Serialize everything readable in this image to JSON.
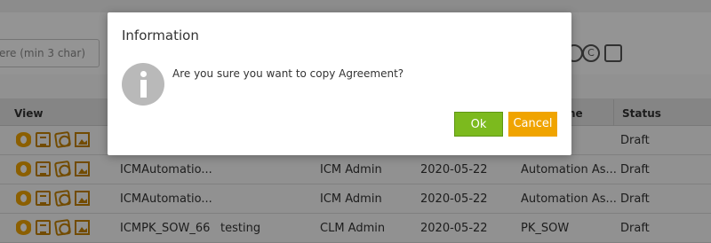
{
  "background": {
    "search": {
      "placeholder": "ere (min 3 char)"
    },
    "grid": {
      "columns": {
        "view": "View",
        "name": "me",
        "status": "Status"
      },
      "rows": [
        {
          "name": "",
          "col3": "",
          "owner": "",
          "date": "",
          "type": "",
          "status": "Draft"
        },
        {
          "name": "ICMAutomatio...",
          "col3": "",
          "owner": "ICM Admin",
          "date": "2020-05-22",
          "type": "Automation As...",
          "status": "Draft"
        },
        {
          "name": "ICMAutomatio...",
          "col3": "",
          "owner": "ICM Admin",
          "date": "2020-05-22",
          "type": "Automation As...",
          "status": "Draft"
        },
        {
          "name": "ICMPK_SOW_66",
          "col3": "testing",
          "owner": "CLM Admin",
          "date": "2020-05-22",
          "type": "PK_SOW",
          "status": "Draft"
        }
      ]
    }
  },
  "dialog": {
    "title": "Information",
    "message": "Are you sure you want to copy Agreement?",
    "ok_label": "Ok",
    "cancel_label": "Cancel",
    "icon": "info-icon"
  }
}
